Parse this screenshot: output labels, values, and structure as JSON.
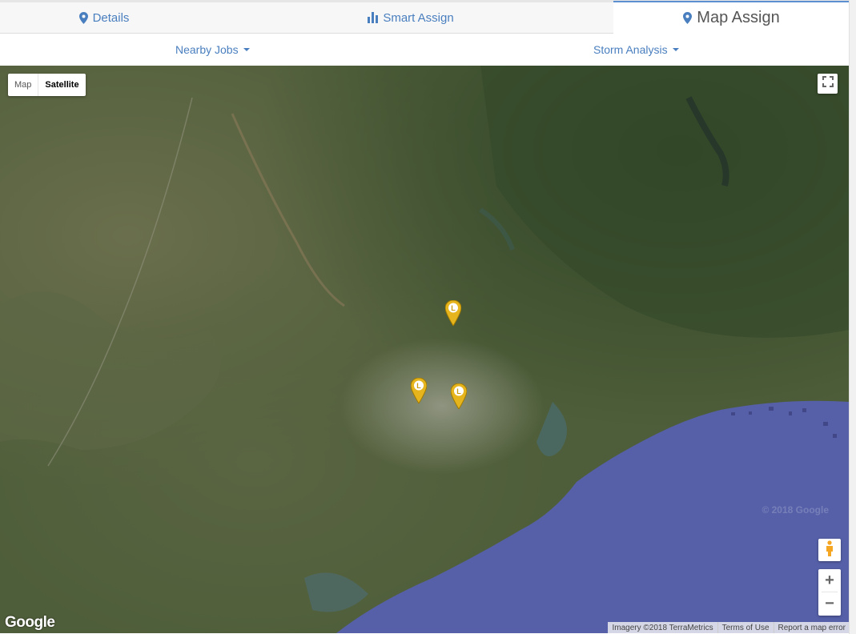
{
  "tabs": [
    {
      "label": "Details",
      "icon": "map-marker-icon"
    },
    {
      "label": "Smart Assign",
      "icon": "bar-chart-icon"
    },
    {
      "label": "Map Assign",
      "icon": "map-marker-icon"
    }
  ],
  "active_tab": "Map Assign",
  "subnav": {
    "nearby_jobs": "Nearby Jobs",
    "storm_analysis": "Storm Analysis"
  },
  "map": {
    "type_map": "Map",
    "type_satellite": "Satellite",
    "selected_type": "Satellite",
    "logo": "Google",
    "watermark": "© 2018 Google",
    "imagery": "Imagery ©2018 TerraMetrics",
    "terms": "Terms of Use",
    "report": "Report a map error",
    "zoom_in": "+",
    "zoom_out": "−",
    "marker_label": "L",
    "marker_color": "#e6b41c",
    "water_color": "#5560a8"
  }
}
